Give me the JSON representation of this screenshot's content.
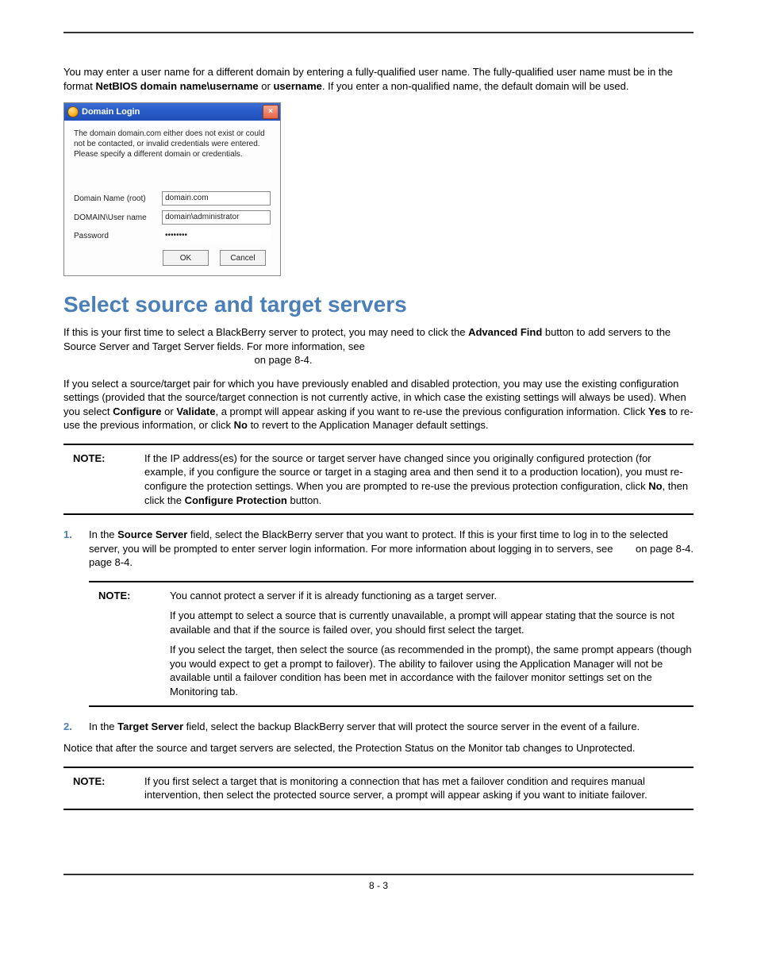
{
  "intro": {
    "line": "You may enter a user name for a different domain by entering a fully-qualified user name. The fully-qualified user name must be in the format ",
    "bold1": "NetBIOS domain name\\username",
    "or": " or ",
    "bold2": "username",
    "tail": ". If you enter a non-qualified name, the default domain will be used."
  },
  "dialog": {
    "title": "Domain Login",
    "close": "×",
    "message": "The domain domain.com either does not exist or could not be contacted, or invalid credentials were entered. Please specify a different domain or credentials.",
    "labels": {
      "domain": "Domain Name (root)",
      "user": "DOMAIN\\User name",
      "pass": "Password"
    },
    "values": {
      "domain": "domain.com",
      "user": "domain\\administrator",
      "pass": "••••••••"
    },
    "ok": "OK",
    "cancel": "Cancel"
  },
  "heading": "Select source and target servers",
  "p1": {
    "a": "If this is your first time to select a BlackBerry server to protect, you may need to click the ",
    "b": "Advanced Find",
    "c": " button to add servers to the Source Server and Target Server fields. For more information, see",
    "d": "on page 8-4."
  },
  "p2": {
    "a": "If you select a source/target pair for which you have previously enabled and disabled protection, you may use the existing configuration settings (provided that the source/target connection is not currently active, in which case the existing settings will always be used). When you select ",
    "b": "Configure",
    "c": " or ",
    "d": "Validate",
    "e": ", a prompt will appear asking if you want to re-use the previous configuration information. Click ",
    "f": "Yes",
    "g": " to re-use the previous information, or click ",
    "h": "No",
    "i": " to revert to the Application Manager default settings."
  },
  "note1": {
    "label": "NOTE:",
    "a": "If the IP address(es) for the source or target server have changed since you originally configured protection (for example, if you configure the source or target in a staging area and then send it to a production location), you must re-configure the protection settings. When you are prompted to re-use the previous protection configuration, click ",
    "b": "No",
    "c": ", then click the ",
    "d": "Configure Protection",
    "e": " button."
  },
  "step1": {
    "num": "1.",
    "a": "In the ",
    "b": "Source Server",
    "c": " field, select the BlackBerry server that you want to protect. If this is your first time to log in to the selected server, you will be prompted to enter server login information. For more information about logging in to servers, see",
    "d": "on page 8-4."
  },
  "note2": {
    "label": "NOTE:",
    "p1": "You cannot protect a server if it is already functioning as a target server.",
    "p2": "If you attempt to select a source that is currently unavailable, a prompt will appear stating that the source is not available and that if the source is failed over, you should first select the target.",
    "p3": "If you select the target, then select the source (as recommended in the prompt), the same prompt appears (though you would expect to get a prompt to failover). The ability to failover using the Application Manager will not be available until a failover condition has been met in accordance with the failover monitor settings set on the Monitoring tab."
  },
  "step2": {
    "num": "2.",
    "a": "In the ",
    "b": "Target Server",
    "c": " field, select the backup BlackBerry server that will protect the source server in the event of a failure."
  },
  "p3": "Notice that after the source and target servers are selected, the Protection Status on the Monitor tab changes to Unprotected.",
  "note3": {
    "label": "NOTE:",
    "body": "If you first select a target that is monitoring a connection that has met a failover condition and requires manual intervention, then select the protected source server, a prompt will appear asking if you want to initiate failover."
  },
  "pagenum": "8 - 3"
}
